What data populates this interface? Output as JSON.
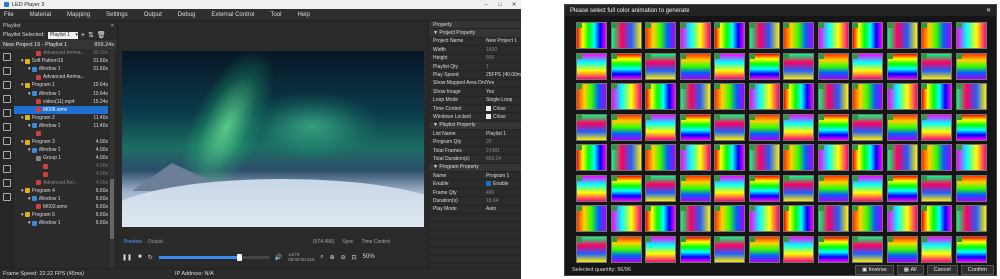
{
  "app": {
    "title": "LED Player 3",
    "window_controls": [
      "–",
      "□",
      "✕"
    ],
    "menu": [
      "File",
      "Material",
      "Mapping",
      "Settings",
      "Output",
      "Debug",
      "External Control",
      "Tool",
      "Help"
    ]
  },
  "playlist": {
    "title": "Playlist",
    "close": "×",
    "selected_label": "Playlist Selected:",
    "selected_value": "Playlist 1",
    "project_name": "New Project 16 - Playlist 1",
    "project_duration": "859.24s",
    "rows": [
      {
        "indent": 3,
        "name": "Advanced Anima...",
        "time": "00.00s",
        "color": "#cc4040",
        "state": "dim"
      },
      {
        "indent": 1,
        "name": "Soft Pattern19",
        "time": "31.60s",
        "color": "#e0b020",
        "state": "normal"
      },
      {
        "indent": 2,
        "name": "Window 1",
        "time": "31.60s",
        "color": "#3a8ad8",
        "state": "normal"
      },
      {
        "indent": 3,
        "name": "Advanced Anima...",
        "time": "",
        "color": "#cc4040",
        "state": "normal"
      },
      {
        "indent": 1,
        "name": "Program 1",
        "time": "10.64s",
        "color": "#e0b020",
        "state": "normal"
      },
      {
        "indent": 2,
        "name": "Window 1",
        "time": "10.64s",
        "color": "#3a8ad8",
        "state": "normal"
      },
      {
        "indent": 3,
        "name": "video(11).mp4",
        "time": "15.24s",
        "color": "#cc4040",
        "state": "normal"
      },
      {
        "indent": 3,
        "name": "M006.wmv",
        "time": "",
        "color": "#cc4040",
        "state": "sel"
      },
      {
        "indent": 1,
        "name": "Program 2",
        "time": "11.40s",
        "color": "#e0b020",
        "state": "normal"
      },
      {
        "indent": 2,
        "name": "Window 1",
        "time": "11.40s",
        "color": "#3a8ad8",
        "state": "normal"
      },
      {
        "indent": 3,
        "name": "",
        "time": "",
        "color": "#cc4040",
        "state": "dim"
      },
      {
        "indent": 1,
        "name": "Program 3",
        "time": "4.00s",
        "color": "#e0b020",
        "state": "normal"
      },
      {
        "indent": 2,
        "name": "Window 1",
        "time": "4.00s",
        "color": "#3a8ad8",
        "state": "normal"
      },
      {
        "indent": 3,
        "name": "Group 1",
        "time": "4.00s",
        "color": "#888888",
        "state": "normal"
      },
      {
        "indent": 4,
        "name": "",
        "time": "4.00s",
        "color": "#cc4040",
        "state": "dim"
      },
      {
        "indent": 4,
        "name": "",
        "time": "4.00s",
        "color": "#cc4040",
        "state": "dim"
      },
      {
        "indent": 3,
        "name": "Advanced Ani...",
        "time": "4.00s",
        "color": "#cc4040",
        "state": "dim"
      },
      {
        "indent": 1,
        "name": "Program 4",
        "time": "5.60s",
        "color": "#e0b020",
        "state": "normal"
      },
      {
        "indent": 2,
        "name": "Window 1",
        "time": "5.60s",
        "color": "#3a8ad8",
        "state": "normal"
      },
      {
        "indent": 3,
        "name": "M003.wmv",
        "time": "5.60s",
        "color": "#cc4040",
        "state": "normal"
      },
      {
        "indent": 1,
        "name": "Program 5",
        "time": "5.60s",
        "color": "#e0b020",
        "state": "normal"
      },
      {
        "indent": 2,
        "name": "Window 1",
        "time": "5.60s",
        "color": "#3a8ad8",
        "state": "normal"
      }
    ]
  },
  "preview": {
    "tab_preview": "Preview",
    "tab_output": "Output",
    "resolution": "(574,456)",
    "sync": "Sync",
    "time_control": "Time Control",
    "timecode_top": "14/74",
    "timecode_bottom": "00:00:00.016",
    "zoom": "50%",
    "progress": 0.73
  },
  "properties": {
    "title": "Property",
    "rows": [
      {
        "type": "sec",
        "label": "▼ Project Property"
      },
      {
        "k": "Project Name",
        "v": "New Project 1"
      },
      {
        "k": "Width",
        "v": "1600",
        "dim": true
      },
      {
        "k": "Height",
        "v": "800",
        "dim": true
      },
      {
        "k": "Playlist Qty",
        "v": "1",
        "dim": true
      },
      {
        "k": "Play Speed",
        "v": "25FPS (40.00m"
      },
      {
        "k": "Show Mapped Area Only",
        "v": "Yes"
      },
      {
        "k": "Show Image",
        "v": "Yes"
      },
      {
        "k": "Loop Mode",
        "v": "Single Loop"
      },
      {
        "k": "Time Control",
        "v": "Close",
        "cb": "off"
      },
      {
        "k": "Windows Locked",
        "v": "Close",
        "cb": "off"
      },
      {
        "type": "sec",
        "label": "▼ Playlist Property"
      },
      {
        "k": "List Name",
        "v": "Playlist 1"
      },
      {
        "k": "Program Qty",
        "v": "20",
        "dim": true
      },
      {
        "k": "Total Frames",
        "v": "21481",
        "dim": true
      },
      {
        "k": "Total Duration(s)",
        "v": "859.24",
        "dim": true
      },
      {
        "type": "sec",
        "label": "▼ Program Property"
      },
      {
        "k": "Name",
        "v": "Program 1"
      },
      {
        "k": "Enable",
        "v": "Enable",
        "cb": "on"
      },
      {
        "k": "Frame Qty",
        "v": "466",
        "dim": true
      },
      {
        "k": "Duration(s)",
        "v": "18.64",
        "dim": true
      },
      {
        "k": "Play Mode",
        "v": "Auto"
      },
      {
        "k": "",
        "v": ""
      },
      {
        "k": "",
        "v": ""
      },
      {
        "k": "",
        "v": ""
      },
      {
        "k": "",
        "v": ""
      },
      {
        "k": "",
        "v": ""
      },
      {
        "k": "",
        "v": ""
      },
      {
        "k": "",
        "v": ""
      }
    ]
  },
  "status": {
    "frame_speed": "Frame Speed: 22.22 FPS (45ms)",
    "ip": "IP Address: N/A"
  },
  "dialog": {
    "title": "Please select full color animation to generate",
    "close": "✕",
    "selected": "Selected quantity: 96/96",
    "buttons": {
      "inverse": "Inverse",
      "all": "All",
      "cancel": "Cancel",
      "confirm": "Confirm"
    },
    "thumb_count": 96
  }
}
